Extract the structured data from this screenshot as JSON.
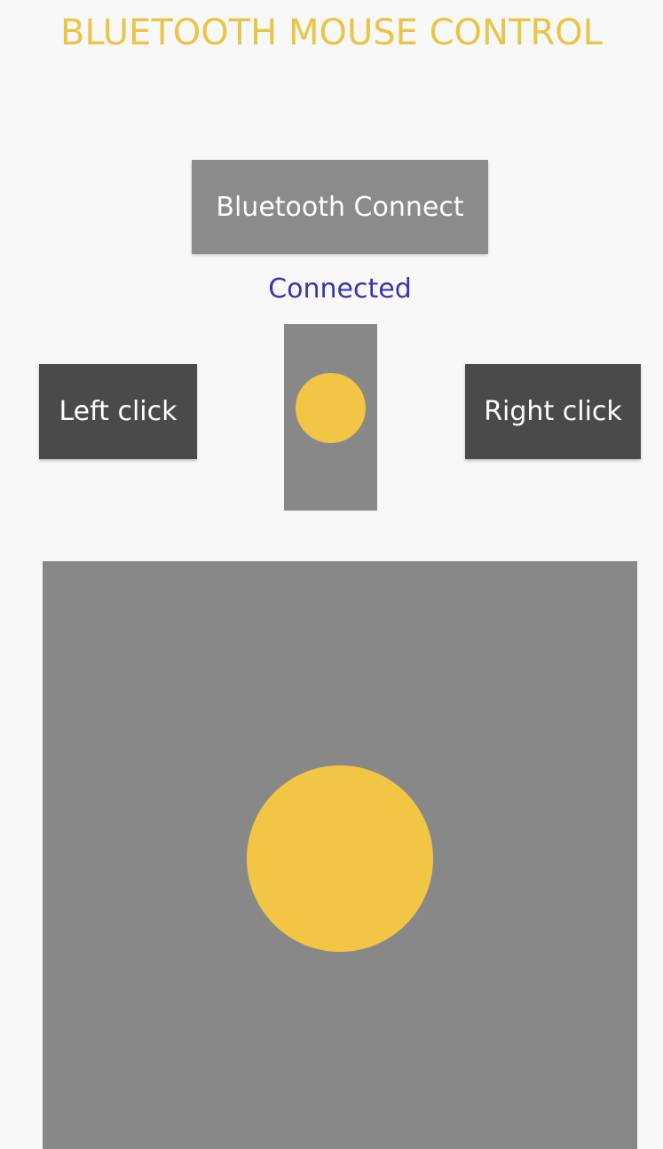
{
  "app": {
    "title": "BLUETOOTH MOUSE CONTROL"
  },
  "connect": {
    "label": "Bluetooth Connect",
    "status": "Connected"
  },
  "mouse_buttons": {
    "left_label": "Left click",
    "right_label": "Right click"
  },
  "colors": {
    "title": "#e9c547",
    "status": "#3a34b0",
    "knob": "#f2c544",
    "pad": "#888888",
    "click_button": "#4a4a4a",
    "connect_button": "#8b8b8b"
  }
}
